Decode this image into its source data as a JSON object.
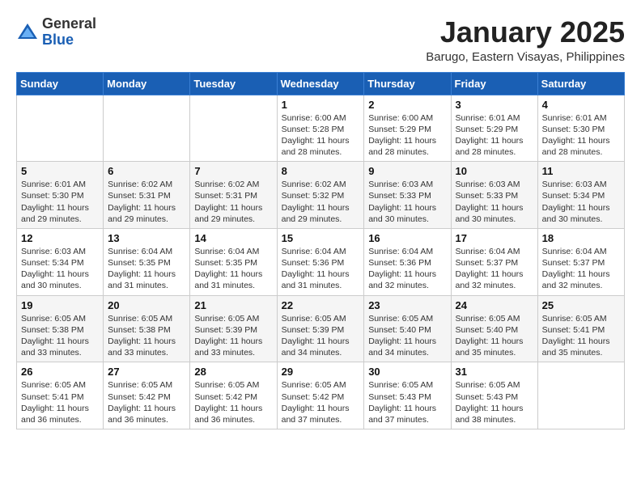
{
  "header": {
    "logo_general": "General",
    "logo_blue": "Blue",
    "month_title": "January 2025",
    "location": "Barugo, Eastern Visayas, Philippines"
  },
  "weekdays": [
    "Sunday",
    "Monday",
    "Tuesday",
    "Wednesday",
    "Thursday",
    "Friday",
    "Saturday"
  ],
  "weeks": [
    [
      {
        "day": "",
        "info": ""
      },
      {
        "day": "",
        "info": ""
      },
      {
        "day": "",
        "info": ""
      },
      {
        "day": "1",
        "info": "Sunrise: 6:00 AM\nSunset: 5:28 PM\nDaylight: 11 hours\nand 28 minutes."
      },
      {
        "day": "2",
        "info": "Sunrise: 6:00 AM\nSunset: 5:29 PM\nDaylight: 11 hours\nand 28 minutes."
      },
      {
        "day": "3",
        "info": "Sunrise: 6:01 AM\nSunset: 5:29 PM\nDaylight: 11 hours\nand 28 minutes."
      },
      {
        "day": "4",
        "info": "Sunrise: 6:01 AM\nSunset: 5:30 PM\nDaylight: 11 hours\nand 28 minutes."
      }
    ],
    [
      {
        "day": "5",
        "info": "Sunrise: 6:01 AM\nSunset: 5:30 PM\nDaylight: 11 hours\nand 29 minutes."
      },
      {
        "day": "6",
        "info": "Sunrise: 6:02 AM\nSunset: 5:31 PM\nDaylight: 11 hours\nand 29 minutes."
      },
      {
        "day": "7",
        "info": "Sunrise: 6:02 AM\nSunset: 5:31 PM\nDaylight: 11 hours\nand 29 minutes."
      },
      {
        "day": "8",
        "info": "Sunrise: 6:02 AM\nSunset: 5:32 PM\nDaylight: 11 hours\nand 29 minutes."
      },
      {
        "day": "9",
        "info": "Sunrise: 6:03 AM\nSunset: 5:33 PM\nDaylight: 11 hours\nand 30 minutes."
      },
      {
        "day": "10",
        "info": "Sunrise: 6:03 AM\nSunset: 5:33 PM\nDaylight: 11 hours\nand 30 minutes."
      },
      {
        "day": "11",
        "info": "Sunrise: 6:03 AM\nSunset: 5:34 PM\nDaylight: 11 hours\nand 30 minutes."
      }
    ],
    [
      {
        "day": "12",
        "info": "Sunrise: 6:03 AM\nSunset: 5:34 PM\nDaylight: 11 hours\nand 30 minutes."
      },
      {
        "day": "13",
        "info": "Sunrise: 6:04 AM\nSunset: 5:35 PM\nDaylight: 11 hours\nand 31 minutes."
      },
      {
        "day": "14",
        "info": "Sunrise: 6:04 AM\nSunset: 5:35 PM\nDaylight: 11 hours\nand 31 minutes."
      },
      {
        "day": "15",
        "info": "Sunrise: 6:04 AM\nSunset: 5:36 PM\nDaylight: 11 hours\nand 31 minutes."
      },
      {
        "day": "16",
        "info": "Sunrise: 6:04 AM\nSunset: 5:36 PM\nDaylight: 11 hours\nand 32 minutes."
      },
      {
        "day": "17",
        "info": "Sunrise: 6:04 AM\nSunset: 5:37 PM\nDaylight: 11 hours\nand 32 minutes."
      },
      {
        "day": "18",
        "info": "Sunrise: 6:04 AM\nSunset: 5:37 PM\nDaylight: 11 hours\nand 32 minutes."
      }
    ],
    [
      {
        "day": "19",
        "info": "Sunrise: 6:05 AM\nSunset: 5:38 PM\nDaylight: 11 hours\nand 33 minutes."
      },
      {
        "day": "20",
        "info": "Sunrise: 6:05 AM\nSunset: 5:38 PM\nDaylight: 11 hours\nand 33 minutes."
      },
      {
        "day": "21",
        "info": "Sunrise: 6:05 AM\nSunset: 5:39 PM\nDaylight: 11 hours\nand 33 minutes."
      },
      {
        "day": "22",
        "info": "Sunrise: 6:05 AM\nSunset: 5:39 PM\nDaylight: 11 hours\nand 34 minutes."
      },
      {
        "day": "23",
        "info": "Sunrise: 6:05 AM\nSunset: 5:40 PM\nDaylight: 11 hours\nand 34 minutes."
      },
      {
        "day": "24",
        "info": "Sunrise: 6:05 AM\nSunset: 5:40 PM\nDaylight: 11 hours\nand 35 minutes."
      },
      {
        "day": "25",
        "info": "Sunrise: 6:05 AM\nSunset: 5:41 PM\nDaylight: 11 hours\nand 35 minutes."
      }
    ],
    [
      {
        "day": "26",
        "info": "Sunrise: 6:05 AM\nSunset: 5:41 PM\nDaylight: 11 hours\nand 36 minutes."
      },
      {
        "day": "27",
        "info": "Sunrise: 6:05 AM\nSunset: 5:42 PM\nDaylight: 11 hours\nand 36 minutes."
      },
      {
        "day": "28",
        "info": "Sunrise: 6:05 AM\nSunset: 5:42 PM\nDaylight: 11 hours\nand 36 minutes."
      },
      {
        "day": "29",
        "info": "Sunrise: 6:05 AM\nSunset: 5:42 PM\nDaylight: 11 hours\nand 37 minutes."
      },
      {
        "day": "30",
        "info": "Sunrise: 6:05 AM\nSunset: 5:43 PM\nDaylight: 11 hours\nand 37 minutes."
      },
      {
        "day": "31",
        "info": "Sunrise: 6:05 AM\nSunset: 5:43 PM\nDaylight: 11 hours\nand 38 minutes."
      },
      {
        "day": "",
        "info": ""
      }
    ]
  ]
}
